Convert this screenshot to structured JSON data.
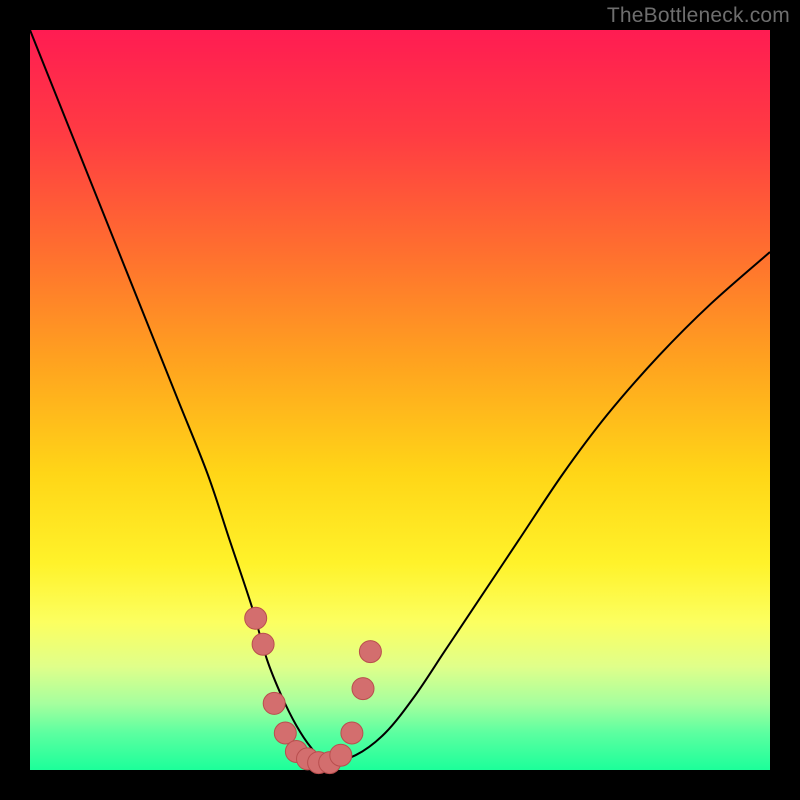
{
  "watermark": "TheBottleneck.com",
  "colors": {
    "frame_bg": "#000000",
    "curve_stroke": "#000000",
    "marker_fill": "#d36e6e",
    "marker_stroke": "#b94e4e",
    "gradient_stops": [
      {
        "pct": 0,
        "color": "#ff1c52"
      },
      {
        "pct": 14,
        "color": "#ff3b43"
      },
      {
        "pct": 30,
        "color": "#ff6f2f"
      },
      {
        "pct": 45,
        "color": "#ffa31f"
      },
      {
        "pct": 60,
        "color": "#ffd617"
      },
      {
        "pct": 72,
        "color": "#fff22a"
      },
      {
        "pct": 80,
        "color": "#fcff60"
      },
      {
        "pct": 86,
        "color": "#e0ff8a"
      },
      {
        "pct": 91,
        "color": "#a6ff9e"
      },
      {
        "pct": 95,
        "color": "#5cffa0"
      },
      {
        "pct": 100,
        "color": "#1cff9a"
      }
    ]
  },
  "chart_data": {
    "type": "line",
    "title": "",
    "xlabel": "",
    "ylabel": "",
    "xlim": [
      0,
      100
    ],
    "ylim": [
      0,
      100
    ],
    "series": [
      {
        "name": "bottleneck-curve",
        "x": [
          0,
          4,
          8,
          12,
          16,
          20,
          24,
          27,
          30,
          32,
          34,
          36,
          38,
          40,
          44,
          48,
          52,
          56,
          60,
          66,
          72,
          78,
          85,
          92,
          100
        ],
        "y": [
          100,
          90,
          80,
          70,
          60,
          50,
          40,
          31,
          22,
          15,
          10,
          6,
          3,
          1,
          2,
          5,
          10,
          16,
          22,
          31,
          40,
          48,
          56,
          63,
          70
        ]
      }
    ],
    "markers": {
      "name": "highlighted-points",
      "x": [
        30.5,
        31.5,
        33.0,
        34.5,
        36.0,
        37.5,
        39.0,
        40.5,
        42.0,
        43.5,
        45.0,
        46.0
      ],
      "y": [
        20.5,
        17.0,
        9.0,
        5.0,
        2.5,
        1.5,
        1.0,
        1.0,
        2.0,
        5.0,
        11.0,
        16.0
      ]
    }
  }
}
